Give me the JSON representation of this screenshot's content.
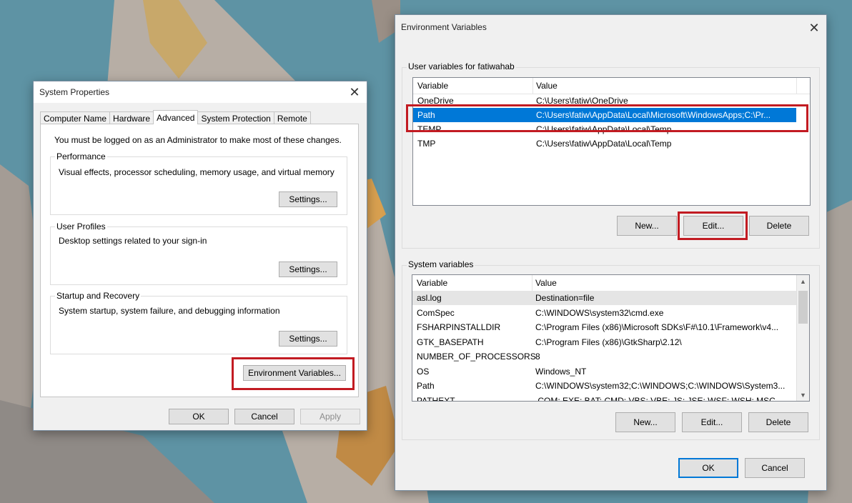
{
  "system_properties": {
    "title": "System Properties",
    "tabs": [
      {
        "label": "Computer Name"
      },
      {
        "label": "Hardware"
      },
      {
        "label": "Advanced"
      },
      {
        "label": "System Protection"
      },
      {
        "label": "Remote"
      }
    ],
    "admin_note": "You must be logged on as an Administrator to make most of these changes.",
    "performance": {
      "label": "Performance",
      "description": "Visual effects, processor scheduling, memory usage, and virtual memory",
      "button": "Settings..."
    },
    "user_profiles": {
      "label": "User Profiles",
      "description": "Desktop settings related to your sign-in",
      "button": "Settings..."
    },
    "startup_recovery": {
      "label": "Startup and Recovery",
      "description": "System startup, system failure, and debugging information",
      "button": "Settings..."
    },
    "env_vars_button": "Environment Variables...",
    "ok": "OK",
    "cancel": "Cancel",
    "apply": "Apply"
  },
  "environment_variables": {
    "title": "Environment Variables",
    "user_section_label": "User variables for fatiwahab",
    "system_section_label": "System variables",
    "columns": {
      "variable": "Variable",
      "value": "Value"
    },
    "user_vars": [
      {
        "name": "OneDrive",
        "value": "C:\\Users\\fatiw\\OneDrive"
      },
      {
        "name": "Path",
        "value": "C:\\Users\\fatiw\\AppData\\Local\\Microsoft\\WindowsApps;C:\\Pr..."
      },
      {
        "name": "TEMP",
        "value": "C:\\Users\\fatiw\\AppData\\Local\\Temp"
      },
      {
        "name": "TMP",
        "value": "C:\\Users\\fatiw\\AppData\\Local\\Temp"
      }
    ],
    "system_vars": [
      {
        "name": "asl.log",
        "value": "Destination=file"
      },
      {
        "name": "ComSpec",
        "value": "C:\\WINDOWS\\system32\\cmd.exe"
      },
      {
        "name": "FSHARPINSTALLDIR",
        "value": "C:\\Program Files (x86)\\Microsoft SDKs\\F#\\10.1\\Framework\\v4..."
      },
      {
        "name": "GTK_BASEPATH",
        "value": "C:\\Program Files (x86)\\GtkSharp\\2.12\\"
      },
      {
        "name": "NUMBER_OF_PROCESSORS",
        "value": "8"
      },
      {
        "name": "OS",
        "value": "Windows_NT"
      },
      {
        "name": "Path",
        "value": "C:\\WINDOWS\\system32;C:\\WINDOWS;C:\\WINDOWS\\System3..."
      },
      {
        "name": "PATHEXT",
        "value": ".COM;.EXE;.BAT;.CMD;.VBS;.VBE;.JS;.JSE;.WSF;.WSH;.MSC"
      }
    ],
    "user_new": "New...",
    "user_edit": "Edit...",
    "user_delete": "Delete",
    "sys_new": "New...",
    "sys_edit": "Edit...",
    "sys_delete": "Delete",
    "ok": "OK",
    "cancel": "Cancel"
  },
  "colors": {
    "highlight": "#c21b22",
    "selection": "#0078d7"
  }
}
